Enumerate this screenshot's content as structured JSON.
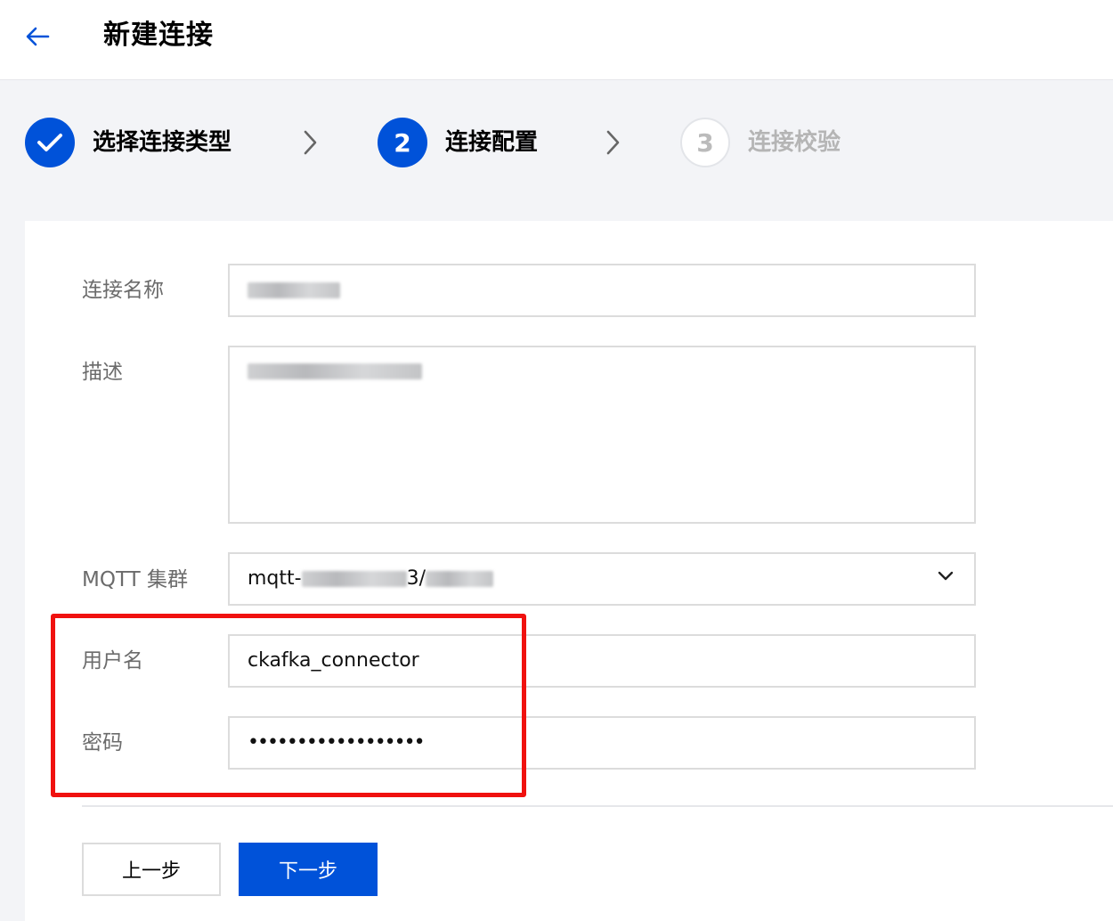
{
  "header": {
    "back_icon": "arrow-left-icon",
    "title": "新建连接"
  },
  "steps": [
    {
      "status": "done",
      "number": "",
      "label": "选择连接类型"
    },
    {
      "status": "active",
      "number": "2",
      "label": "连接配置"
    },
    {
      "status": "pending",
      "number": "3",
      "label": "连接校验"
    }
  ],
  "form": {
    "name": {
      "label": "连接名称",
      "value": ""
    },
    "description": {
      "label": "描述",
      "value": ""
    },
    "cluster": {
      "label": "MQTT 集群",
      "value_prefix": "mqtt-",
      "value_mid": "3/",
      "value_suffix": ""
    },
    "username": {
      "label": "用户名",
      "value": "ckafka_connector"
    },
    "password": {
      "label": "密码",
      "value": "••••••••••••••••••"
    }
  },
  "buttons": {
    "prev": "上一步",
    "next": "下一步"
  },
  "colors": {
    "primary": "#0052d9",
    "highlight": "#f0110f",
    "pending_text": "#b5b5b5"
  }
}
